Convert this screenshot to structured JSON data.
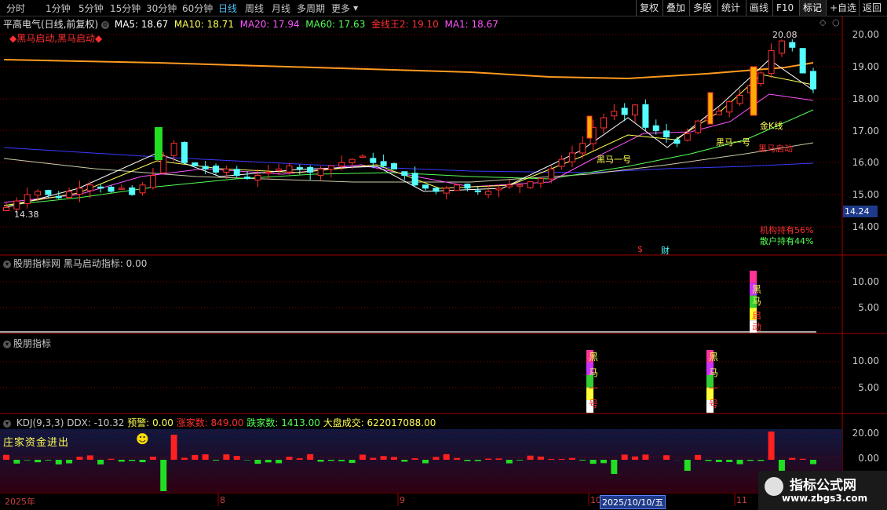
{
  "toolbar": {
    "timeframes": [
      "分时",
      "1分钟",
      "5分钟",
      "15分钟",
      "30分钟",
      "60分钟",
      "日线",
      "周线",
      "月线",
      "多周期",
      "更多"
    ],
    "active_timeframe": "日线",
    "buttons": [
      "复权",
      "叠加",
      "多股",
      "统计",
      "画线",
      "F10",
      "标记",
      "+自选",
      "返回"
    ],
    "active_button": "标记"
  },
  "main_chart": {
    "title": "平高电气(日线,前复权)",
    "legend": [
      {
        "label": "MA5: 18.67",
        "color": "#ffffff"
      },
      {
        "label": "MA10: 18.71",
        "color": "#ffff55"
      },
      {
        "label": "MA20: 17.94",
        "color": "#ff55ff"
      },
      {
        "label": "MA60: 17.63",
        "color": "#55ff55"
      },
      {
        "label": "金线王2: 19.10",
        "color": "#ff3030"
      },
      {
        "label": "MA1: 18.67",
        "color": "#ff55ff"
      }
    ],
    "signal_text": "◆黑马启动,黑马启动◆",
    "high_label": "20.08",
    "low_label": "14.38",
    "current_price": "14.24",
    "annotations": [
      "黑马一号",
      "黑马一号",
      "金K线",
      "黑马启动"
    ],
    "holdings": [
      "机构持有56%",
      "散户持有44%"
    ],
    "event_markers": [
      "$",
      "财"
    ],
    "y_axis": [
      "20.00",
      "19.00",
      "18.00",
      "17.00",
      "16.00",
      "15.00",
      "14.00"
    ]
  },
  "panel1": {
    "header": "股朋指标网 黑马启动指标: 0.00",
    "y_axis": [
      "10.00",
      "5.00"
    ],
    "signal_chars": [
      "黑",
      "马",
      "启",
      "动"
    ]
  },
  "panel2": {
    "header": "股朋指标",
    "y_axis": [
      "10.00",
      "5.00"
    ],
    "signal_chars": [
      "黑",
      "马",
      "一",
      "号"
    ]
  },
  "panel3": {
    "header_items": [
      {
        "label": "KDJ(9,3,3)",
        "color": "#c8c8c8"
      },
      {
        "label": "DDX: -10.32",
        "color": "#c8c8c8"
      },
      {
        "label": "预警: 0.00",
        "color": "#ffff55"
      },
      {
        "label": "涨家数: 849.00",
        "color": "#ff3030"
      },
      {
        "label": "跌家数: 1413.00",
        "color": "#55ff55"
      },
      {
        "label": "大盘成交: 622017088.00",
        "color": "#ffff55"
      }
    ],
    "tag": "庄家资金进出",
    "emoji": "☻",
    "y_axis": [
      "20.00",
      "0.00"
    ]
  },
  "date_axis": {
    "labels": [
      "2025年",
      "8",
      "9",
      "10",
      "2025/10/10/五",
      "11"
    ],
    "highlight": "2025/10/10/五"
  },
  "watermark": {
    "title": "指标公式网",
    "url": "www.zbgs3.com"
  },
  "colors": {
    "up": "#ff3030",
    "down": "#55ffff",
    "grid": "#8b0000",
    "accent": "#4fc3f7"
  }
}
